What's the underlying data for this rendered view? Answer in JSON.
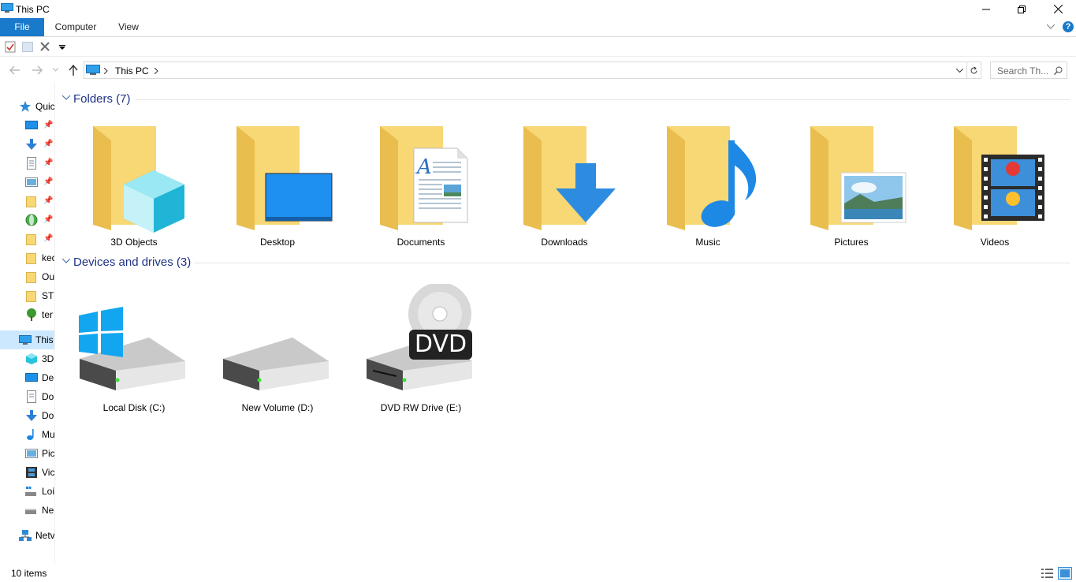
{
  "window": {
    "title": "This PC"
  },
  "ribbon": {
    "tabs": [
      {
        "label": "File"
      },
      {
        "label": "Computer"
      },
      {
        "label": "View"
      }
    ],
    "help_label": "?"
  },
  "address": {
    "breadcrumb": [
      "This PC"
    ],
    "search_placeholder": "Search Th..."
  },
  "navpane": {
    "items": [
      {
        "label": "Quic",
        "icon": "quick-access-star-icon"
      },
      {
        "label": "",
        "icon": "desktop-icon",
        "pinned": true
      },
      {
        "label": "",
        "icon": "downloads-icon",
        "pinned": true
      },
      {
        "label": "",
        "icon": "documents-icon",
        "pinned": true
      },
      {
        "label": "",
        "icon": "pictures-icon",
        "pinned": true
      },
      {
        "label": "",
        "icon": "folder-icon",
        "pinned": true
      },
      {
        "label": "",
        "icon": "globe-folder-icon",
        "pinned": true
      },
      {
        "label": "",
        "icon": "folder-icon",
        "pinned": true
      },
      {
        "label": "kec",
        "icon": "folder-icon"
      },
      {
        "label": "Ou",
        "icon": "folder-icon"
      },
      {
        "label": "STI",
        "icon": "folder-icon"
      },
      {
        "label": "ter",
        "icon": "tree-icon"
      },
      {
        "label": "This",
        "icon": "this-pc-icon"
      },
      {
        "label": "3D",
        "icon": "3d-objects-icon"
      },
      {
        "label": "De",
        "icon": "desktop-icon"
      },
      {
        "label": "Do",
        "icon": "documents-icon"
      },
      {
        "label": "Do",
        "icon": "downloads-icon"
      },
      {
        "label": "Mu",
        "icon": "music-icon"
      },
      {
        "label": "Pic",
        "icon": "pictures-icon"
      },
      {
        "label": "Vic",
        "icon": "videos-icon"
      },
      {
        "label": "Loi",
        "icon": "local-disk-icon"
      },
      {
        "label": "Ne",
        "icon": "drive-icon"
      },
      {
        "label": "Netv",
        "icon": "network-icon"
      }
    ]
  },
  "content": {
    "folders_header": "Folders (7)",
    "folders": [
      {
        "label": "3D Objects",
        "icon": "3d-objects-folder-icon"
      },
      {
        "label": "Desktop",
        "icon": "desktop-folder-icon"
      },
      {
        "label": "Documents",
        "icon": "documents-folder-icon"
      },
      {
        "label": "Downloads",
        "icon": "downloads-folder-icon"
      },
      {
        "label": "Music",
        "icon": "music-folder-icon"
      },
      {
        "label": "Pictures",
        "icon": "pictures-folder-icon"
      },
      {
        "label": "Videos",
        "icon": "videos-folder-icon"
      }
    ],
    "drives_header": "Devices and drives (3)",
    "drives": [
      {
        "label": "Local Disk (C:)",
        "icon": "windows-drive-icon"
      },
      {
        "label": "New Volume (D:)",
        "icon": "hard-drive-icon"
      },
      {
        "label": "DVD RW Drive (E:)",
        "icon": "dvd-drive-icon",
        "badge": "DVD"
      }
    ]
  },
  "status": {
    "item_count": "10 items"
  },
  "colors": {
    "accent": "#1979ca",
    "group_header": "#1e3287",
    "folder": "#f8d775",
    "selected": "#cce8ff"
  }
}
